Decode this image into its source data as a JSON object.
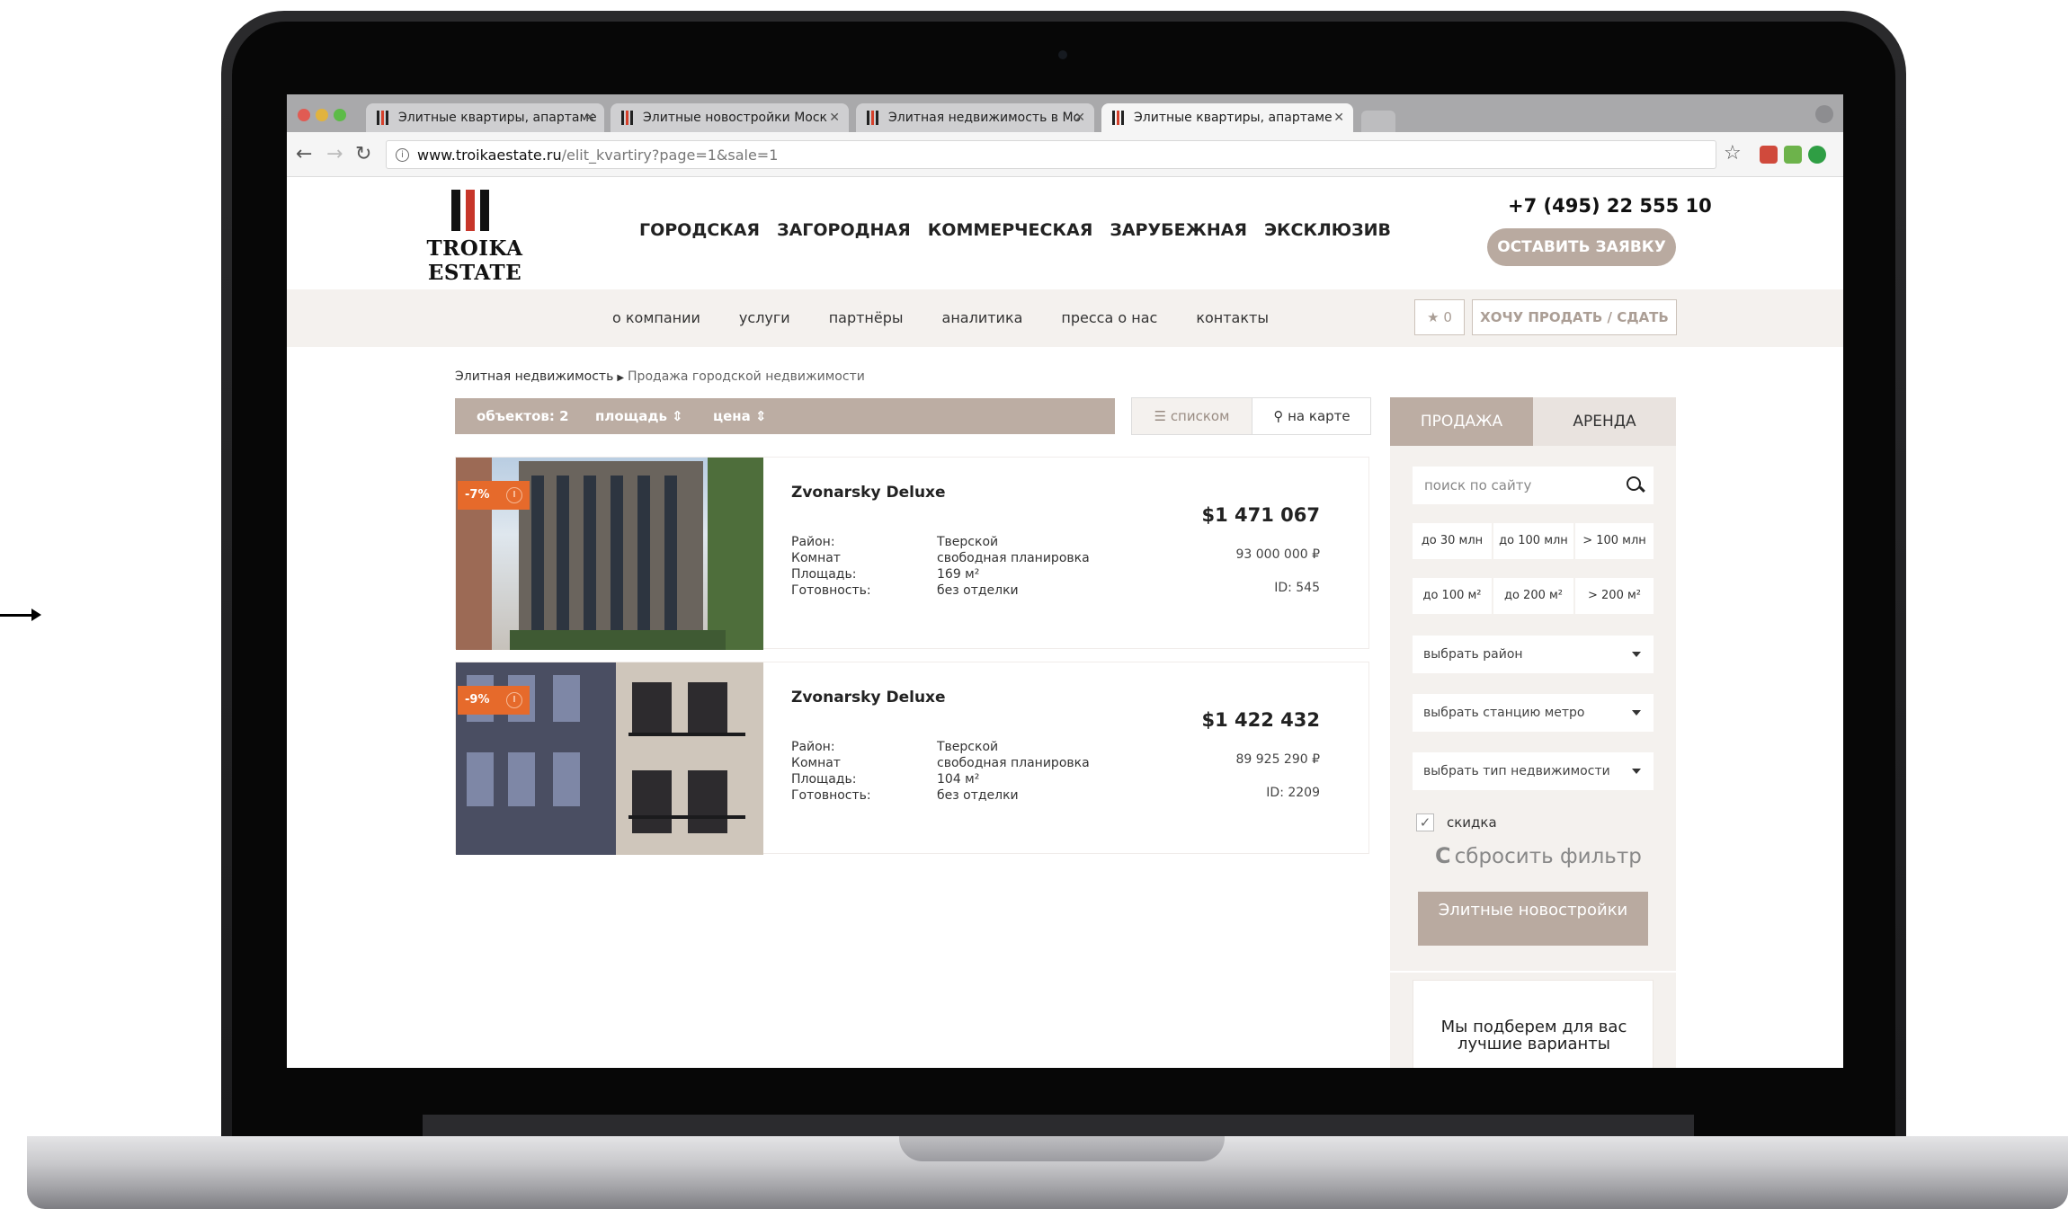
{
  "browser": {
    "tabs": [
      {
        "title": "Элитные квартиры, апартаме"
      },
      {
        "title": "Элитные новостройки Моск"
      },
      {
        "title": "Элитная недвижимость в Мо"
      },
      {
        "title": "Элитные квартиры, апартаме"
      }
    ],
    "url_host": "www.troikaestate.ru",
    "url_path": "/elit_kvartiry?page=1&sale=1"
  },
  "header": {
    "logo_text": "TROIKA ESTATE",
    "nav": [
      "ГОРОДСКАЯ",
      "ЗАГОРОДНАЯ",
      "КОММЕРЧЕСКАЯ",
      "ЗАРУБЕЖНАЯ",
      "ЭКСКЛЮЗИВ"
    ],
    "phone": "+7 (495) 22 555 10",
    "cta": "ОСТАВИТЬ ЗАЯВКУ"
  },
  "subnav": {
    "items": [
      "о компании",
      "услуги",
      "партнёры",
      "аналитика",
      "пресса о нас",
      "контакты"
    ],
    "favorites_count": "0",
    "sell_button": "ХОЧУ ПРОДАТЬ / СДАТЬ"
  },
  "breadcrumb": {
    "root": "Элитная недвижимость",
    "current": "Продажа городской недвижимости"
  },
  "sortbar": {
    "count": "объектов: 2",
    "area": "площадь ⇕",
    "price": "цена ⇕"
  },
  "view": {
    "list": "списком",
    "map": "на карте"
  },
  "listings": [
    {
      "discount": "-7%",
      "title": "Zvonarsky Deluxe",
      "props": [
        {
          "key": "Район:",
          "value": "Тверской"
        },
        {
          "key": "Комнат",
          "value": "свободная планировка"
        },
        {
          "key": "Площадь:",
          "value": "169 м²"
        },
        {
          "key": "Готовность:",
          "value": "без отделки"
        }
      ],
      "price_usd": "$1 471 067",
      "price_rub": "93 000 000 ₽",
      "id": "ID: 545"
    },
    {
      "discount": "-9%",
      "title": "Zvonarsky Deluxe",
      "props": [
        {
          "key": "Район:",
          "value": "Тверской"
        },
        {
          "key": "Комнат",
          "value": "свободная планировка"
        },
        {
          "key": "Площадь:",
          "value": "104 м²"
        },
        {
          "key": "Готовность:",
          "value": "без отделки"
        }
      ],
      "price_usd": "$1 422 432",
      "price_rub": "89 925 290 ₽",
      "id": "ID: 2209"
    }
  ],
  "sidebar": {
    "tab_sale": "ПРОДАЖА",
    "tab_rent": "АРЕНДА",
    "search_placeholder": "поиск по сайту",
    "price_chips": [
      "до 30 млн",
      "до 100 млн",
      "> 100 млн"
    ],
    "area_chips": [
      "до 100 м²",
      "до 200 м²",
      "> 200 м²"
    ],
    "select_district": "выбрать район",
    "select_metro": "выбрать станцию метро",
    "select_type": "выбрать тип недвижимости",
    "discount_label": "скидка",
    "reset": "сбросить фильтр",
    "newbuild_button": "Элитные новостройки",
    "card_text": "Мы подберем для вас лучшие варианты"
  }
}
